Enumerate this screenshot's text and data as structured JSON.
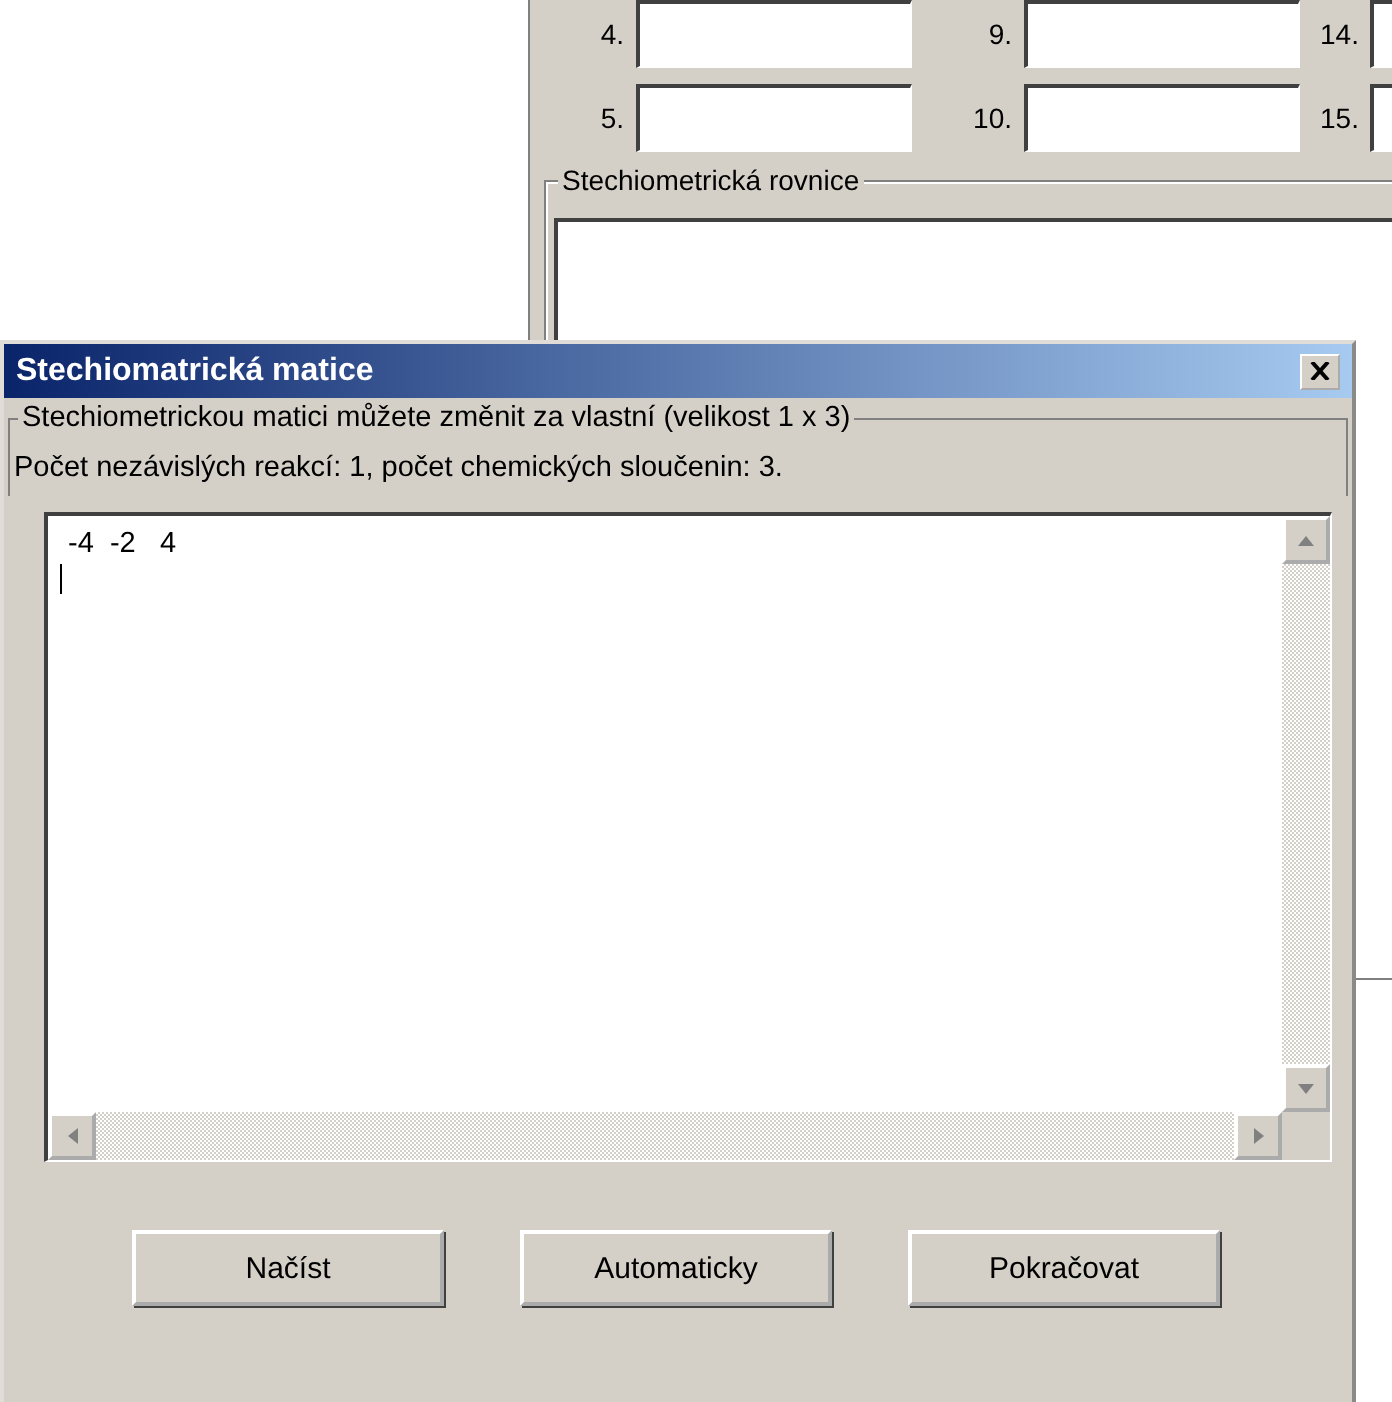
{
  "background_window": {
    "fields": [
      {
        "label": "4."
      },
      {
        "label": "9."
      },
      {
        "label": "14."
      },
      {
        "label": "5."
      },
      {
        "label": "10."
      },
      {
        "label": "15."
      }
    ],
    "group_title": "Stechiometrická rovnice"
  },
  "dialog": {
    "title": "Stechiomatrická matice",
    "group_title": "Stechiometrickou matici můžete změnit za vlastní (velikost 1 x 3)",
    "info": "Počet nezávislých reakcí: 1, počet chemických sloučenin: 3.",
    "matrix_text": " -4  -2   4",
    "buttons": [
      "Načíst",
      "Automaticky",
      "Pokračovat"
    ]
  }
}
